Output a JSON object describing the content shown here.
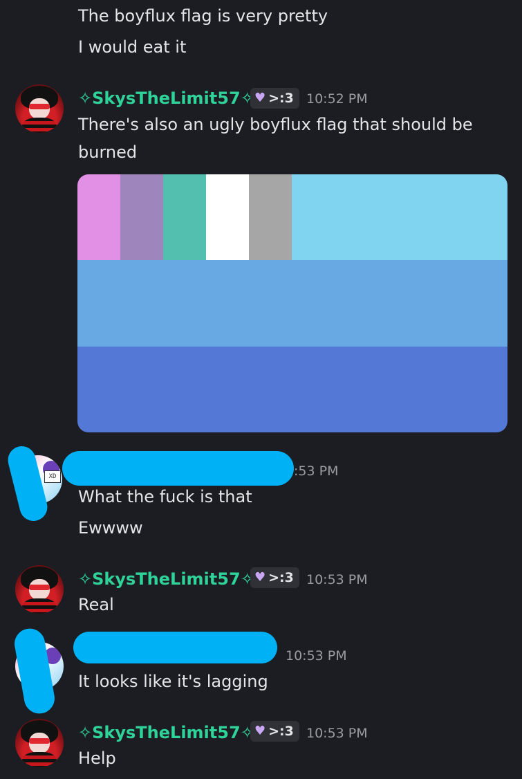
{
  "messages_top": {
    "line1": "The boyflux flag is very pretty",
    "line2": "I would eat it"
  },
  "msg1": {
    "author": "✧SkysTheLimit57✧",
    "tag": ">:3",
    "time": "10:52 PM",
    "line1": "There's also an ugly boyflux flag that should be",
    "line2": "burned"
  },
  "flag_colors": {
    "top_blocks": [
      "#e28fe6",
      "#9e86bd",
      "#52bfaf",
      "#ffffff",
      "#a6a6a6"
    ],
    "top_rest": "#80d4ef",
    "middle": "#68a9e4",
    "bottom": "#5478d6"
  },
  "msg2": {
    "avatar_text": "XD",
    "time": ":53 PM",
    "line1": "What the fuck is that",
    "line2": "Ewwww"
  },
  "msg3": {
    "author": "✧SkysTheLimit57✧",
    "tag": ">:3",
    "time": "10:53 PM",
    "line1": "Real"
  },
  "msg4": {
    "time": "10:53 PM",
    "line1": "It looks like it's lagging"
  },
  "msg5": {
    "author": "✧SkysTheLimit57✧",
    "tag": ">:3",
    "time": "10:53 PM",
    "line1": "Help"
  },
  "colors": {
    "background": "#1c1d22",
    "username": "#2fd39a",
    "redaction": "#00b2f5"
  },
  "icons": {
    "tag_icon": "heart-icon"
  }
}
